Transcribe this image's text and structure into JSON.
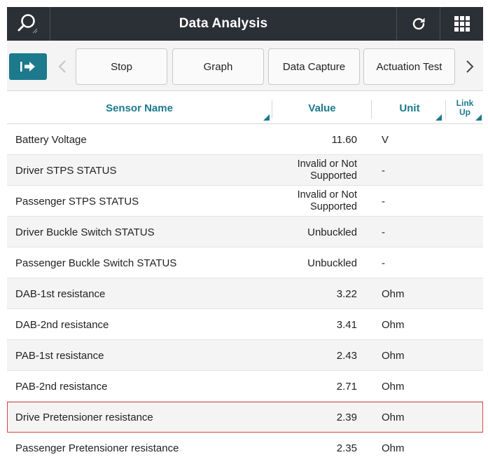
{
  "header": {
    "title": "Data Analysis",
    "icons": [
      "search-icon",
      "refresh-icon",
      "grid-menu-icon"
    ],
    "bg_color": "#2b2f36"
  },
  "toolbar": {
    "exit_icon": "exit-arrow-icon",
    "buttons": [
      {
        "label": "Stop"
      },
      {
        "label": "Graph"
      },
      {
        "label": "Data Capture"
      },
      {
        "label": "Actuation Test"
      }
    ],
    "accent_color": "#1c7a8c"
  },
  "table": {
    "columns": {
      "name": "Sensor Name",
      "value": "Value",
      "unit": "Unit",
      "link_top": "Link",
      "link_bottom": "Up"
    },
    "rows": [
      {
        "name": "Battery Voltage",
        "value": "11.60",
        "unit": "V"
      },
      {
        "name": "Driver STPS STATUS",
        "value_line1": "Invalid or Not",
        "value_line2": "Supported",
        "unit": "-"
      },
      {
        "name": "Passenger STPS STATUS",
        "value_line1": "Invalid or Not",
        "value_line2": "Supported",
        "unit": "-"
      },
      {
        "name": "Driver Buckle Switch STATUS",
        "value": "Unbuckled",
        "unit": "-"
      },
      {
        "name": "Passenger Buckle Switch STATUS",
        "value": "Unbuckled",
        "unit": "-"
      },
      {
        "name": "DAB-1st resistance",
        "value": "3.22",
        "unit": "Ohm"
      },
      {
        "name": "DAB-2nd resistance",
        "value": "3.41",
        "unit": "Ohm"
      },
      {
        "name": "PAB-1st resistance",
        "value": "2.43",
        "unit": "Ohm"
      },
      {
        "name": "PAB-2nd resistance",
        "value": "2.71",
        "unit": "Ohm"
      },
      {
        "name": "Drive Pretensioner resistance",
        "value": "2.39",
        "unit": "Ohm",
        "selected": true
      },
      {
        "name": "Passenger Pretensioner resistance",
        "value": "2.35",
        "unit": "Ohm"
      }
    ],
    "selected_color": "#dd4444",
    "alt_row_color": "#f4f4f4"
  }
}
